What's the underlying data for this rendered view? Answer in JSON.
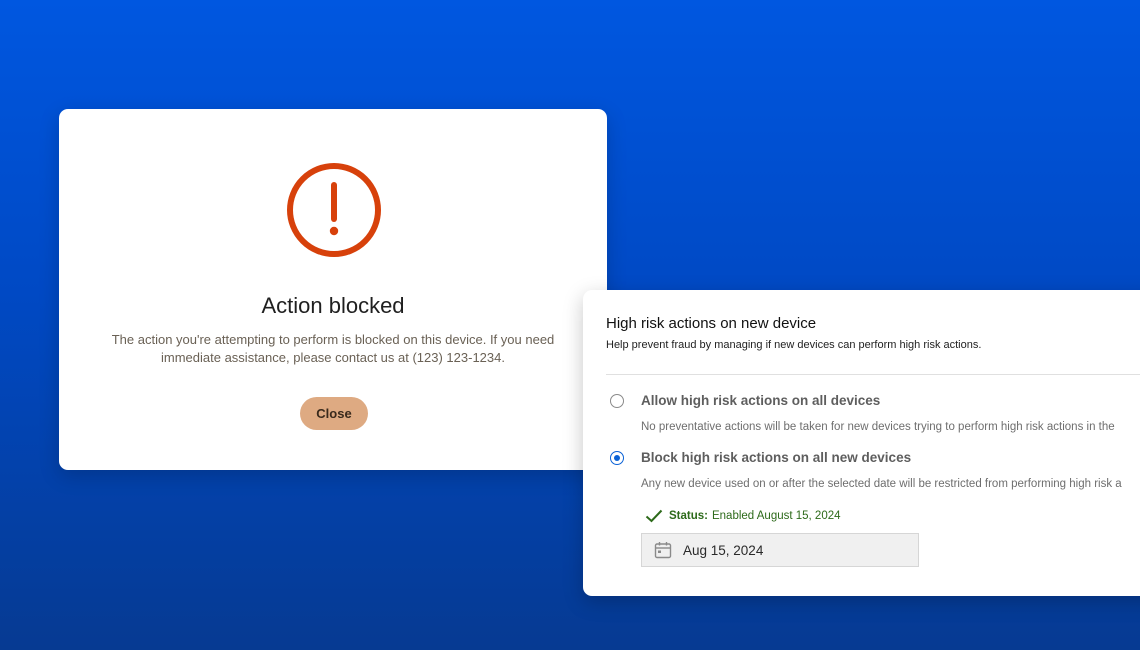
{
  "dialog": {
    "icon": "alert-circle-icon",
    "title": "Action blocked",
    "message": "The action you're attempting to perform is blocked on this device. If you need immediate assistance, please contact us at (123) 123-1234.",
    "close_label": "Close",
    "accent_color": "#d7410b",
    "button_color": "#deaa82"
  },
  "panel": {
    "title": "High risk actions on new device",
    "subtitle": "Help prevent fraud by managing if new devices can perform high risk actions.",
    "options": [
      {
        "label": "Allow high risk actions on all devices",
        "description": "No preventative actions will be taken for new devices trying to perform high risk actions in the",
        "selected": false
      },
      {
        "label": "Block high risk actions on all new devices",
        "description": "Any new device used on or after the selected date will be restricted from performing high risk a",
        "selected": true
      }
    ],
    "status": {
      "icon": "check-icon",
      "key": "Status:",
      "value": "Enabled August 15, 2024"
    },
    "date_field": {
      "icon": "calendar-icon",
      "value": "Aug 15, 2024"
    }
  },
  "colors": {
    "background_top": "#0057e0",
    "background_bottom": "#063a92",
    "radio_selected": "#0b62d6",
    "status_green": "#2d6a1a"
  }
}
